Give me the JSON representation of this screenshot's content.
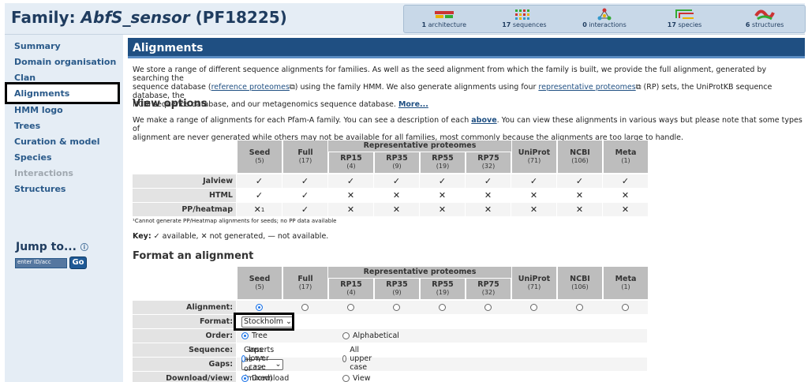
{
  "header": {
    "family_prefix": "Family: ",
    "family_name": "AbfS_sensor",
    "family_id": "(PF18225)"
  },
  "stats": [
    {
      "icon": "architecture-icon",
      "count": "1",
      "label": "architecture"
    },
    {
      "icon": "sequences-icon",
      "count": "17",
      "label": "sequences"
    },
    {
      "icon": "interactions-icon",
      "count": "0",
      "label": "interactions"
    },
    {
      "icon": "species-icon",
      "count": "17",
      "label": "species"
    },
    {
      "icon": "structures-icon",
      "count": "6",
      "label": "structures"
    }
  ],
  "sidebar": {
    "items": [
      "Summary",
      "Domain organisation",
      "Clan",
      "Alignments",
      "HMM logo",
      "Trees",
      "Curation & model",
      "Species",
      "Interactions",
      "Structures"
    ],
    "jump_label": "Jump to...",
    "jump_placeholder": "enter ID/acc",
    "go": "Go"
  },
  "main": {
    "title": "Alignments",
    "intro_1": "We store a range of different sequence alignments for families. As well as the seed alignment from which the family is built, we provide the full alignment, generated by searching the",
    "intro_2a": "sequence database (",
    "intro_link1": "reference proteomes",
    "intro_2b": ") using the family HMM. We also generate alignments using four ",
    "intro_link2": "representative proteomes",
    "intro_2c": " (RP) sets, the UniProtKB sequence database, the",
    "intro_3": "NCBI sequence database, and our metagenomics sequence database.",
    "more": "More...",
    "view_heading": "View options",
    "view_1a": "We make a range of alignments for each Pfam-A family. You can see a description of each ",
    "view_link": "above",
    "view_1b": ". You can view these alignments in various ways but please note that some types of",
    "view_2": "alignment are never generated while others may not be available for all families, most commonly because the alignments are too large to handle.",
    "rp_header": "Representative proteomes",
    "columns": [
      {
        "name": "Seed",
        "count": "(5)"
      },
      {
        "name": "Full",
        "count": "(17)"
      },
      {
        "name": "RP15",
        "count": "(4)"
      },
      {
        "name": "RP35",
        "count": "(9)"
      },
      {
        "name": "RP55",
        "count": "(19)"
      },
      {
        "name": "RP75",
        "count": "(32)"
      },
      {
        "name": "UniProt",
        "count": "(71)"
      },
      {
        "name": "NCBI",
        "count": "(106)"
      },
      {
        "name": "Meta",
        "count": "(1)"
      }
    ],
    "view_rows": [
      {
        "label": "Jalview",
        "cells": [
          "✓",
          "✓",
          "✓",
          "✓",
          "✓",
          "✓",
          "✓",
          "✓",
          "✓"
        ]
      },
      {
        "label": "HTML",
        "cells": [
          "✓",
          "✓",
          "✕",
          "✕",
          "✕",
          "✕",
          "✕",
          "✕",
          "✕"
        ]
      },
      {
        "label": "PP/heatmap",
        "cells": [
          "✕",
          "✓",
          "✕",
          "✕",
          "✕",
          "✕",
          "✕",
          "✕",
          "✕"
        ]
      }
    ],
    "pp_footnote_mark": "1",
    "footnote": "¹Cannot generate PP/Heatmap alignments for seeds; no PP data available",
    "key_label": "Key:",
    "key_available": "available,",
    "key_not_generated": "not generated,",
    "key_not_available": "— not available.",
    "format_heading": "Format an alignment",
    "fmt_rows": {
      "alignment": "Alignment:",
      "format": "Format:",
      "order": "Order:",
      "sequence": "Sequence:",
      "gaps": "Gaps:",
      "download": "Download/view:"
    },
    "format_value": "Stockholm",
    "order_opts": [
      "Tree",
      "Alphabetical"
    ],
    "sequence_opts": [
      "Inserts lower case",
      "All upper case"
    ],
    "gaps_value": "Gaps as \".\" or \"-\" (mixed)",
    "download_opts": [
      "Download",
      "View"
    ]
  }
}
